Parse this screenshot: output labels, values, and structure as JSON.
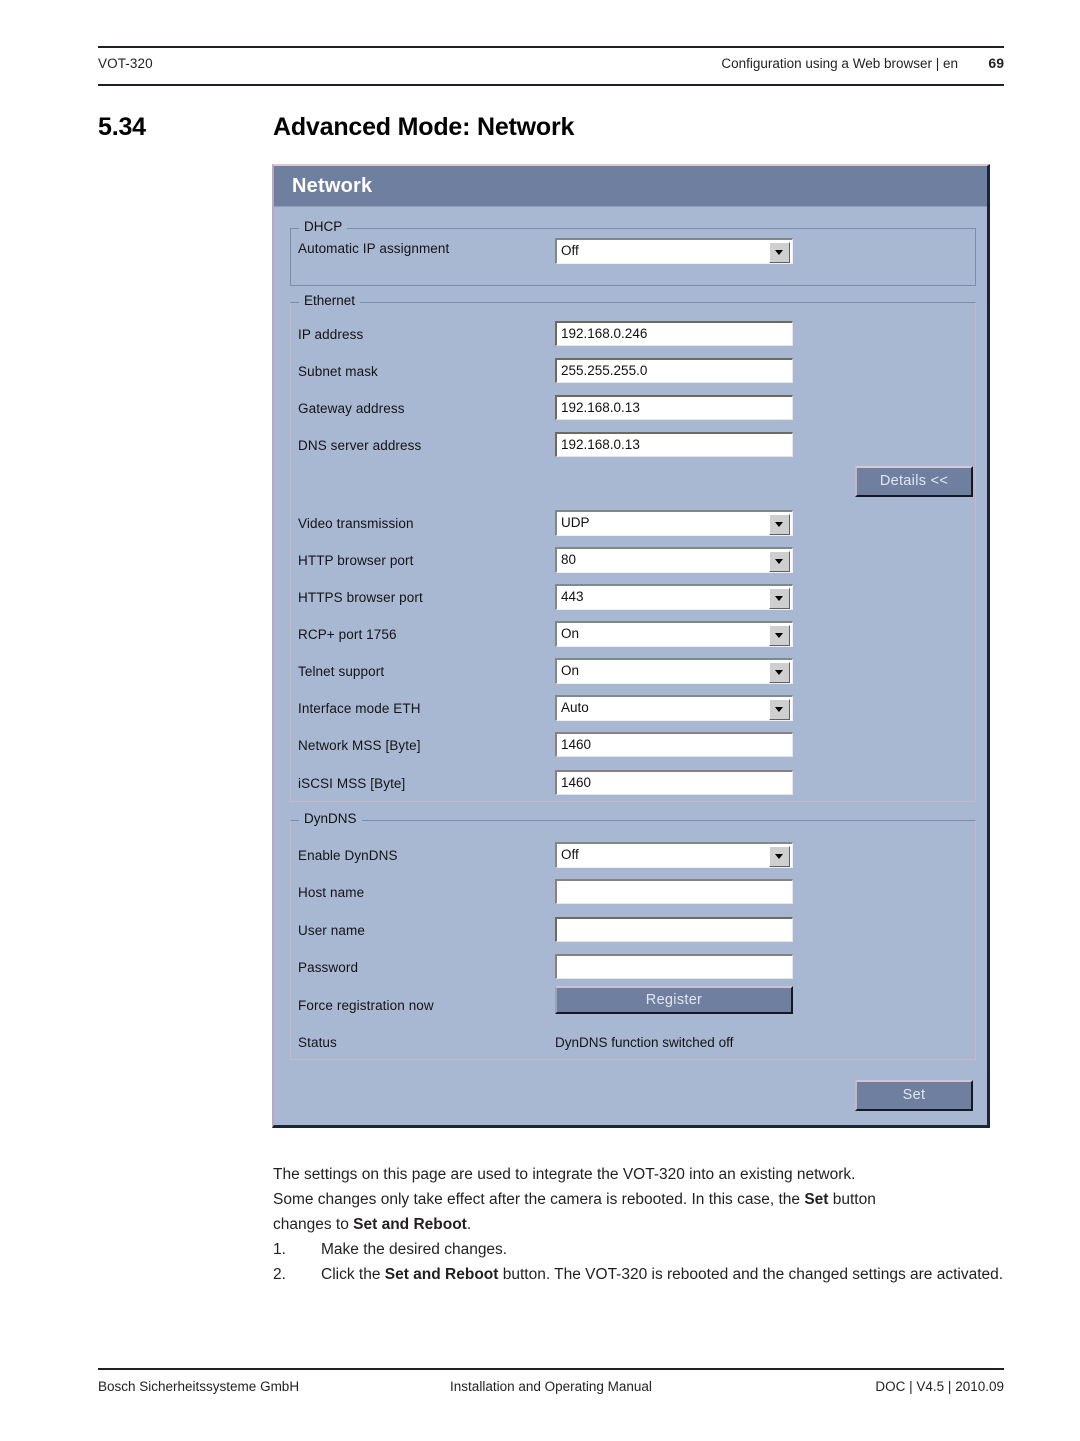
{
  "page_header": {
    "left": "VOT-320",
    "right": "Configuration using a Web browser | en",
    "page_number": "69"
  },
  "section": {
    "number": "5.34",
    "title": "Advanced Mode: Network"
  },
  "screenshot": {
    "window_title": "Network",
    "colors": {
      "title_bar": "#6e7fa0",
      "panel_background": "#a8b7d2",
      "button_face": "#6e7fa0",
      "field_background": "#ffffff"
    },
    "groups": [
      {
        "legend": "DHCP",
        "rows": [
          {
            "label": "Automatic IP assignment",
            "control": "select",
            "value": "Off"
          }
        ]
      },
      {
        "legend": "Ethernet",
        "rows": [
          {
            "label": "IP address",
            "control": "text",
            "value": "192.168.0.246"
          },
          {
            "label": "Subnet mask",
            "control": "text",
            "value": "255.255.255.0"
          },
          {
            "label": "Gateway address",
            "control": "text",
            "value": "192.168.0.13"
          },
          {
            "label": "DNS server address",
            "control": "text",
            "value": "192.168.0.13"
          },
          {
            "label": "Video transmission",
            "control": "select",
            "value": "UDP"
          },
          {
            "label": "HTTP browser port",
            "control": "select",
            "value": "80"
          },
          {
            "label": "HTTPS browser port",
            "control": "select",
            "value": "443"
          },
          {
            "label": "RCP+ port 1756",
            "control": "select",
            "value": "On"
          },
          {
            "label": "Telnet support",
            "control": "select",
            "value": "On"
          },
          {
            "label": "Interface mode ETH",
            "control": "select",
            "value": "Auto"
          },
          {
            "label": "Network MSS [Byte]",
            "control": "text",
            "value": "1460"
          },
          {
            "label": "iSCSI MSS [Byte]",
            "control": "text",
            "value": "1460"
          }
        ],
        "details_button": "Details <<"
      },
      {
        "legend": "DynDNS",
        "rows": [
          {
            "label": "Enable DynDNS",
            "control": "select",
            "value": "Off"
          },
          {
            "label": "Host name",
            "control": "text",
            "value": ""
          },
          {
            "label": "User name",
            "control": "text",
            "value": ""
          },
          {
            "label": "Password",
            "control": "text",
            "value": ""
          },
          {
            "label": "Force registration now",
            "control": "button",
            "value": "Register"
          },
          {
            "label": "Status",
            "control": "static",
            "value": "DynDNS function switched off"
          }
        ]
      }
    ],
    "set_button": "Set"
  },
  "body": {
    "paragraph_1": "The settings on this page are used to integrate the VOT-320 into an existing network.",
    "paragraph_2_a": "Some changes only take effect after the camera is rebooted. In this case, the ",
    "paragraph_2_bold": "Set",
    "paragraph_2_b": " button",
    "paragraph_3_a": "changes to ",
    "paragraph_3_bold": "Set and Reboot",
    "paragraph_3_b": ".",
    "list": [
      {
        "num": "1.",
        "text": "Make the desired changes."
      },
      {
        "num": "2.",
        "prefix": "Click the ",
        "bold": "Set and Reboot",
        "suffix": " button. The VOT-320 is rebooted and the changed settings are activated."
      }
    ]
  },
  "page_footer": {
    "left": "Bosch Sicherheitssysteme GmbH",
    "center": "Installation and Operating Manual",
    "right": "DOC | V4.5 | 2010.09"
  }
}
